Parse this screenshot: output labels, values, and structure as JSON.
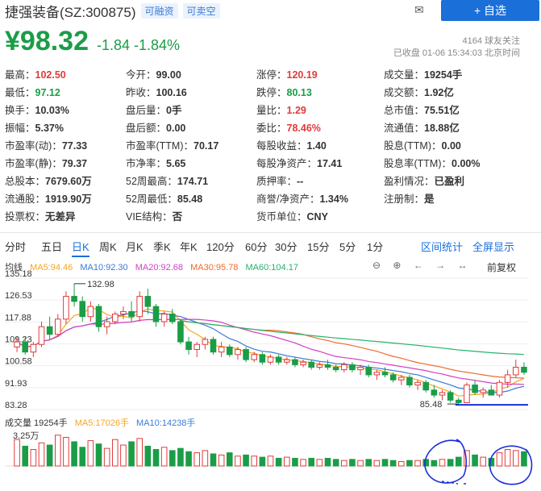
{
  "header": {
    "stock_name": "捷强装备(SZ:300875)",
    "badge1": "可融资",
    "badge2": "可卖空",
    "add_label": "+ 自选",
    "price": "¥98.32",
    "change": "-1.84 -1.84%",
    "followers": "4164 球友关注",
    "status": "已收盘 01-06 15:34:03 北京时间"
  },
  "stats": [
    {
      "k": "最高：",
      "v": "102.50",
      "c": "red"
    },
    {
      "k": "今开：",
      "v": "99.00",
      "c": ""
    },
    {
      "k": "涨停：",
      "v": "120.19",
      "c": "red"
    },
    {
      "k": "成交量：",
      "v": "19254手",
      "c": ""
    },
    {
      "k": "最低：",
      "v": "97.12",
      "c": "green"
    },
    {
      "k": "昨收：",
      "v": "100.16",
      "c": ""
    },
    {
      "k": "跌停：",
      "v": "80.13",
      "c": "green"
    },
    {
      "k": "成交额：",
      "v": "1.92亿",
      "c": ""
    },
    {
      "k": "换手：",
      "v": "10.03%",
      "c": ""
    },
    {
      "k": "盘后量：",
      "v": "0手",
      "c": ""
    },
    {
      "k": "量比：",
      "v": "1.29",
      "c": "red"
    },
    {
      "k": "总市值：",
      "v": "75.51亿",
      "c": ""
    },
    {
      "k": "振幅：",
      "v": "5.37%",
      "c": ""
    },
    {
      "k": "盘后额：",
      "v": "0.00",
      "c": ""
    },
    {
      "k": "委比：",
      "v": "78.46%",
      "c": "red"
    },
    {
      "k": "流通值：",
      "v": "18.88亿",
      "c": ""
    },
    {
      "k": "市盈率(动)：",
      "v": "77.33",
      "c": ""
    },
    {
      "k": "市盈率(TTM)：",
      "v": "70.17",
      "c": ""
    },
    {
      "k": "每股收益：",
      "v": "1.40",
      "c": ""
    },
    {
      "k": "股息(TTM)：",
      "v": "0.00",
      "c": ""
    },
    {
      "k": "市盈率(静)：",
      "v": "79.37",
      "c": ""
    },
    {
      "k": "市净率：",
      "v": "5.65",
      "c": ""
    },
    {
      "k": "每股净资产：",
      "v": "17.41",
      "c": ""
    },
    {
      "k": "股息率(TTM)：",
      "v": "0.00%",
      "c": ""
    },
    {
      "k": "总股本：",
      "v": "7679.60万",
      "c": ""
    },
    {
      "k": "52周最高：",
      "v": "174.71",
      "c": ""
    },
    {
      "k": "质押率：",
      "v": "--",
      "c": ""
    },
    {
      "k": "盈利情况：",
      "v": "已盈利",
      "c": ""
    },
    {
      "k": "流通股：",
      "v": "1919.90万",
      "c": ""
    },
    {
      "k": "52周最低：",
      "v": "85.48",
      "c": ""
    },
    {
      "k": "商誉/净资产：",
      "v": "1.34%",
      "c": ""
    },
    {
      "k": "注册制：",
      "v": "是",
      "c": ""
    },
    {
      "k": "投票权：",
      "v": "无差异",
      "c": ""
    },
    {
      "k": "VIE结构：",
      "v": "否",
      "c": ""
    },
    {
      "k": "货币单位：",
      "v": "CNY",
      "c": ""
    }
  ],
  "tabs": [
    "分时",
    "五日",
    "日K",
    "周K",
    "月K",
    "季K",
    "年K",
    "120分",
    "60分",
    "30分",
    "15分",
    "5分",
    "1分"
  ],
  "active_tab": "日K",
  "tab_right": [
    "区间统计",
    "全屏显示"
  ],
  "ma": {
    "label": "均线",
    "ma5": "MA5:94.46",
    "ma10": "MA10:92.30",
    "ma20": "MA20:92.68",
    "ma30": "MA30:95.78",
    "ma60": "MA60:104.17"
  },
  "tools": [
    "⊖",
    "⊕",
    "←",
    "→",
    "↔"
  ],
  "fq": "前复权",
  "yaxis": [
    "135.18",
    "126.53",
    "117.88",
    "109.23",
    "100.58",
    "91.93",
    "83.28"
  ],
  "hi_label": "132.98",
  "lo_label": "85.48",
  "vol": {
    "label": "成交量 19254手",
    "ma5": "MA5:17026手",
    "ma10": "MA10:14238手",
    "ytick": "3.25万"
  },
  "colors": {
    "up": "#e03b3b",
    "down": "#1a9d47",
    "ma5": "#f5a623",
    "ma10": "#3a7bd5",
    "ma20": "#d43fbf",
    "ma30": "#f06b2e",
    "ma60": "#27b36b",
    "annotation": "#1a2fd9"
  },
  "chart_data": {
    "type": "candlestick",
    "ylim": [
      83.28,
      135.18
    ],
    "candles": [
      [
        108,
        112,
        106,
        110
      ],
      [
        110,
        112,
        105,
        106
      ],
      [
        106,
        110,
        104,
        109
      ],
      [
        109,
        118,
        108,
        116
      ],
      [
        116,
        120,
        111,
        113
      ],
      [
        113,
        121,
        112,
        119
      ],
      [
        119,
        130,
        117,
        128
      ],
      [
        128,
        133,
        124,
        126
      ],
      [
        126,
        128,
        118,
        120
      ],
      [
        120,
        126,
        118,
        124
      ],
      [
        124,
        125,
        114,
        116
      ],
      [
        116,
        120,
        113,
        118
      ],
      [
        118,
        122,
        117,
        121
      ],
      [
        121,
        124,
        119,
        122
      ],
      [
        122,
        126,
        118,
        120
      ],
      [
        120,
        130,
        118,
        128
      ],
      [
        128,
        131,
        121,
        124
      ],
      [
        124,
        125,
        116,
        118
      ],
      [
        118,
        122,
        116,
        121
      ],
      [
        121,
        123,
        117,
        118
      ],
      [
        118,
        119,
        109,
        110
      ],
      [
        110,
        112,
        105,
        107
      ],
      [
        107,
        110,
        104,
        109
      ],
      [
        109,
        112,
        107,
        111
      ],
      [
        111,
        112,
        105,
        106
      ],
      [
        106,
        110,
        104,
        108
      ],
      [
        108,
        109,
        104,
        105
      ],
      [
        105,
        108,
        103,
        107
      ],
      [
        107,
        108,
        102,
        103
      ],
      [
        103,
        106,
        102,
        105
      ],
      [
        105,
        106,
        101,
        102
      ],
      [
        102,
        105,
        101,
        104
      ],
      [
        104,
        105,
        101,
        102
      ],
      [
        102,
        104,
        101,
        103
      ],
      [
        103,
        104,
        100,
        101
      ],
      [
        101,
        103,
        100,
        102
      ],
      [
        102,
        103,
        99,
        100
      ],
      [
        100,
        102,
        99,
        101
      ],
      [
        101,
        103,
        99,
        100
      ],
      [
        100,
        101,
        98,
        99
      ],
      [
        99,
        102,
        98,
        101
      ],
      [
        101,
        102,
        98,
        99
      ],
      [
        99,
        101,
        97,
        100
      ],
      [
        100,
        101,
        96,
        97
      ],
      [
        97,
        99,
        95,
        98
      ],
      [
        98,
        100,
        96,
        97
      ],
      [
        97,
        98,
        94,
        95
      ],
      [
        95,
        97,
        93,
        96
      ],
      [
        96,
        97,
        92,
        93
      ],
      [
        93,
        95,
        91,
        94
      ],
      [
        94,
        95,
        90,
        91
      ],
      [
        91,
        93,
        88,
        89
      ],
      [
        89,
        91,
        87,
        90
      ],
      [
        90,
        91,
        86,
        87
      ],
      [
        87,
        88,
        85.48,
        86
      ],
      [
        86,
        94,
        86,
        93
      ],
      [
        93,
        95,
        89,
        90
      ],
      [
        90,
        92,
        88,
        91
      ],
      [
        91,
        93,
        89,
        89
      ],
      [
        89,
        95,
        88,
        94
      ],
      [
        94,
        99,
        92,
        97
      ],
      [
        97,
        103,
        96,
        100
      ],
      [
        100,
        102,
        97,
        98
      ]
    ],
    "volumes": [
      2.4,
      1.8,
      1.5,
      2.1,
      1.9,
      2.8,
      2.6,
      2.2,
      1.7,
      2.3,
      2.0,
      1.6,
      2.4,
      1.9,
      2.2,
      2.5,
      1.8,
      1.5,
      1.7,
      1.4,
      1.6,
      1.3,
      1.2,
      1.4,
      1.1,
      1.0,
      1.2,
      0.9,
      1.0,
      0.9,
      0.8,
      0.9,
      0.7,
      0.8,
      0.7,
      0.6,
      0.7,
      0.6,
      0.7,
      0.6,
      0.5,
      0.6,
      0.5,
      0.6,
      0.5,
      0.6,
      0.5,
      0.4,
      0.5,
      0.5,
      0.6,
      0.5,
      0.6,
      0.6,
      0.8,
      1.4,
      1.0,
      0.8,
      0.7,
      1.2,
      1.5,
      1.4,
      1.3
    ]
  }
}
